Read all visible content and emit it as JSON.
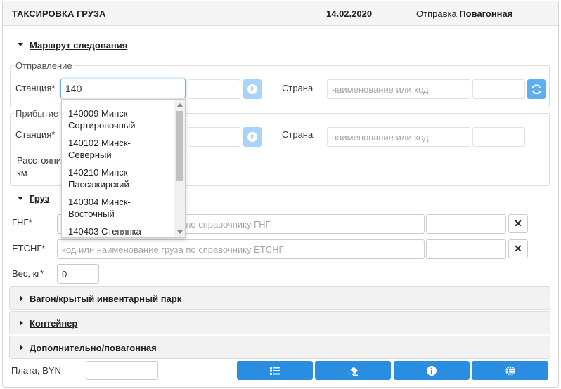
{
  "header": {
    "title": "ТАКСИРОВКА ГРУЗА",
    "date": "14.02.2020",
    "shipment_label": "Отправка",
    "shipment_value": "Повагонная"
  },
  "route": {
    "title": "Маршрут следования",
    "departure": {
      "legend": "Отправление",
      "station_label": "Станция*",
      "station_value": "140",
      "country_label": "Страна",
      "country_placeholder": "наименование или код"
    },
    "arrival": {
      "legend": "Прибытие",
      "station_label": "Станция*",
      "country_label": "Страна",
      "country_placeholder": "наименование или код",
      "distance_label_1": "Расстояние,",
      "distance_label_2": "км"
    }
  },
  "station_dropdown": {
    "items": [
      {
        "line1": "140009 Минск-",
        "line2": "Сортировочный"
      },
      {
        "line1": "140102 Минск-",
        "line2": "Северный"
      },
      {
        "line1": "140210 Минск-",
        "line2": "Пассажирский"
      },
      {
        "line1": "140304 Минск-",
        "line2": "Восточный"
      },
      {
        "line1": "140403 Степянка",
        "line2": ""
      }
    ]
  },
  "cargo": {
    "title": "Груз",
    "gng_label": "ГНГ*",
    "gng_placeholder": "код или наименование груза по справочнику ГНГ",
    "etsng_label": "ЕТСНГ*",
    "etsng_placeholder": "код или наименование груза по справочнику ЕТСНГ",
    "weight_label": "Вес, кг*",
    "weight_value": "0",
    "clear_symbol": "✕"
  },
  "sections": {
    "wagon": "Вагон/крытый инвентарный парк",
    "container": "Контейнер",
    "additional": "Дополнительно/повагонная"
  },
  "footer": {
    "payment_label": "Плата, BYN",
    "buttons": [
      {
        "icon": "list-icon"
      },
      {
        "icon": "eraser-icon"
      },
      {
        "icon": "info-icon"
      },
      {
        "icon": "globe-icon"
      }
    ]
  },
  "colors": {
    "accent": "#2a8ee0",
    "icon_button_light": "#a8d4f7"
  }
}
